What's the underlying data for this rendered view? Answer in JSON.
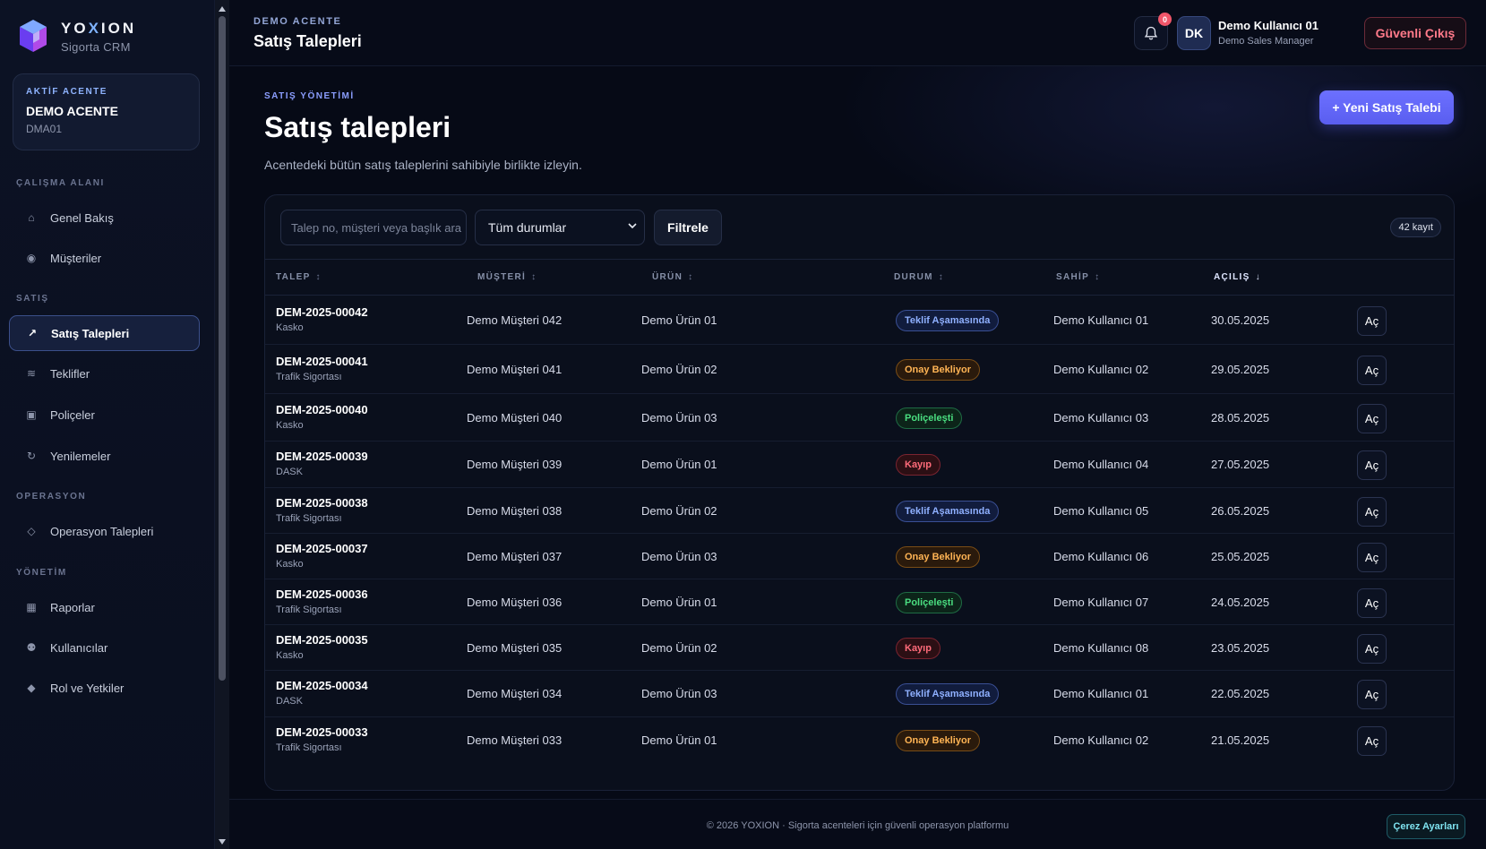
{
  "brand": {
    "name_pre": "YO",
    "name_x": "X",
    "name_post": "ION",
    "subtitle": "Sigorta CRM"
  },
  "agency": {
    "eyebrow": "AKTİF ACENTE",
    "name": "DEMO ACENTE",
    "code": "DMA01"
  },
  "sidebar": {
    "sections": [
      "ÇALIŞMA ALANI",
      "SATIŞ",
      "OPERASYON",
      "YÖNETİM"
    ],
    "items": [
      {
        "label": "Genel Bakış",
        "icon": "home-icon",
        "glyph": "⌂"
      },
      {
        "label": "Müşteriler",
        "icon": "users-icon",
        "glyph": "◉"
      },
      {
        "label": "Satış Talepleri",
        "icon": "arrow-up-right-icon",
        "glyph": "↗"
      },
      {
        "label": "Teklifler",
        "icon": "waves-icon",
        "glyph": "≋"
      },
      {
        "label": "Poliçeler",
        "icon": "document-icon",
        "glyph": "▣"
      },
      {
        "label": "Yenilemeler",
        "icon": "refresh-icon",
        "glyph": "↻"
      },
      {
        "label": "Operasyon Talepleri",
        "icon": "diamond-icon",
        "glyph": "◇"
      },
      {
        "label": "Raporlar",
        "icon": "chart-icon",
        "glyph": "▦"
      },
      {
        "label": "Kullanıcılar",
        "icon": "user-icon",
        "glyph": "⚉"
      },
      {
        "label": "Rol ve Yetkiler",
        "icon": "shield-icon",
        "glyph": "◆"
      }
    ]
  },
  "topbar": {
    "eyebrow": "DEMO ACENTE",
    "title": "Satış Talepleri",
    "notification_count": "0",
    "avatar_initials": "DK",
    "user_name": "Demo Kullanıcı 01",
    "user_role": "Demo Sales Manager",
    "logout_label": "Güvenli Çıkış"
  },
  "page": {
    "eyebrow": "SATIŞ YÖNETİMİ",
    "title": "Satış talepleri",
    "subtitle": "Acentedeki bütün satış taleplerini sahibiyle birlikte izleyin.",
    "new_button": "+ Yeni Satış Talebi"
  },
  "filters": {
    "search_placeholder": "Talep no, müşteri veya başlık ara",
    "status_value": "Tüm durumlar",
    "filter_button": "Filtrele",
    "record_count": "42 kayıt"
  },
  "table": {
    "headers": [
      "TALEP",
      "MÜŞTERİ",
      "ÜRÜN",
      "DURUM",
      "SAHİP",
      "AÇILIŞ"
    ],
    "sort_glyphs": [
      "↕",
      "↕",
      "↕",
      "↕",
      "↕",
      "↓"
    ],
    "open_label": "Aç",
    "rows": [
      {
        "no": "DEM-2025-00042",
        "type": "Kasko",
        "customer": "Demo Müşteri 042",
        "product": "Demo Ürün 01",
        "status": "Teklif Aşamasında",
        "status_kind": "teklif",
        "owner": "Demo Kullanıcı 01",
        "date": "30.05.2025"
      },
      {
        "no": "DEM-2025-00041",
        "type": "Trafik Sigortası",
        "customer": "Demo Müşteri 041",
        "product": "Demo Ürün 02",
        "status": "Onay Bekliyor",
        "status_kind": "onay",
        "owner": "Demo Kullanıcı 02",
        "date": "29.05.2025"
      },
      {
        "no": "DEM-2025-00040",
        "type": "Kasko",
        "customer": "Demo Müşteri 040",
        "product": "Demo Ürün 03",
        "status": "Poliçeleşti",
        "status_kind": "police",
        "owner": "Demo Kullanıcı 03",
        "date": "28.05.2025"
      },
      {
        "no": "DEM-2025-00039",
        "type": "DASK",
        "customer": "Demo Müşteri 039",
        "product": "Demo Ürün 01",
        "status": "Kayıp",
        "status_kind": "kayip",
        "owner": "Demo Kullanıcı 04",
        "date": "27.05.2025"
      },
      {
        "no": "DEM-2025-00038",
        "type": "Trafik Sigortası",
        "customer": "Demo Müşteri 038",
        "product": "Demo Ürün 02",
        "status": "Teklif Aşamasında",
        "status_kind": "teklif",
        "owner": "Demo Kullanıcı 05",
        "date": "26.05.2025"
      },
      {
        "no": "DEM-2025-00037",
        "type": "Kasko",
        "customer": "Demo Müşteri 037",
        "product": "Demo Ürün 03",
        "status": "Onay Bekliyor",
        "status_kind": "onay",
        "owner": "Demo Kullanıcı 06",
        "date": "25.05.2025"
      },
      {
        "no": "DEM-2025-00036",
        "type": "Trafik Sigortası",
        "customer": "Demo Müşteri 036",
        "product": "Demo Ürün 01",
        "status": "Poliçeleşti",
        "status_kind": "police",
        "owner": "Demo Kullanıcı 07",
        "date": "24.05.2025"
      },
      {
        "no": "DEM-2025-00035",
        "type": "Kasko",
        "customer": "Demo Müşteri 035",
        "product": "Demo Ürün 02",
        "status": "Kayıp",
        "status_kind": "kayip",
        "owner": "Demo Kullanıcı 08",
        "date": "23.05.2025"
      },
      {
        "no": "DEM-2025-00034",
        "type": "DASK",
        "customer": "Demo Müşteri 034",
        "product": "Demo Ürün 03",
        "status": "Teklif Aşamasında",
        "status_kind": "teklif",
        "owner": "Demo Kullanıcı 01",
        "date": "22.05.2025"
      },
      {
        "no": "DEM-2025-00033",
        "type": "Trafik Sigortası",
        "customer": "Demo Müşteri 033",
        "product": "Demo Ürün 01",
        "status": "Onay Bekliyor",
        "status_kind": "onay",
        "owner": "Demo Kullanıcı 02",
        "date": "21.05.2025"
      }
    ]
  },
  "footer": {
    "text": "© 2026 YOXION · Sigorta acenteleri için güvenli operasyon platformu",
    "cookie_button": "Çerez Ayarları"
  },
  "colors": {
    "accent": "#5a5ef0",
    "teklif": "#8fb0ff",
    "onay": "#ffb454",
    "police": "#4ade80",
    "kayip": "#ff6b7a"
  }
}
